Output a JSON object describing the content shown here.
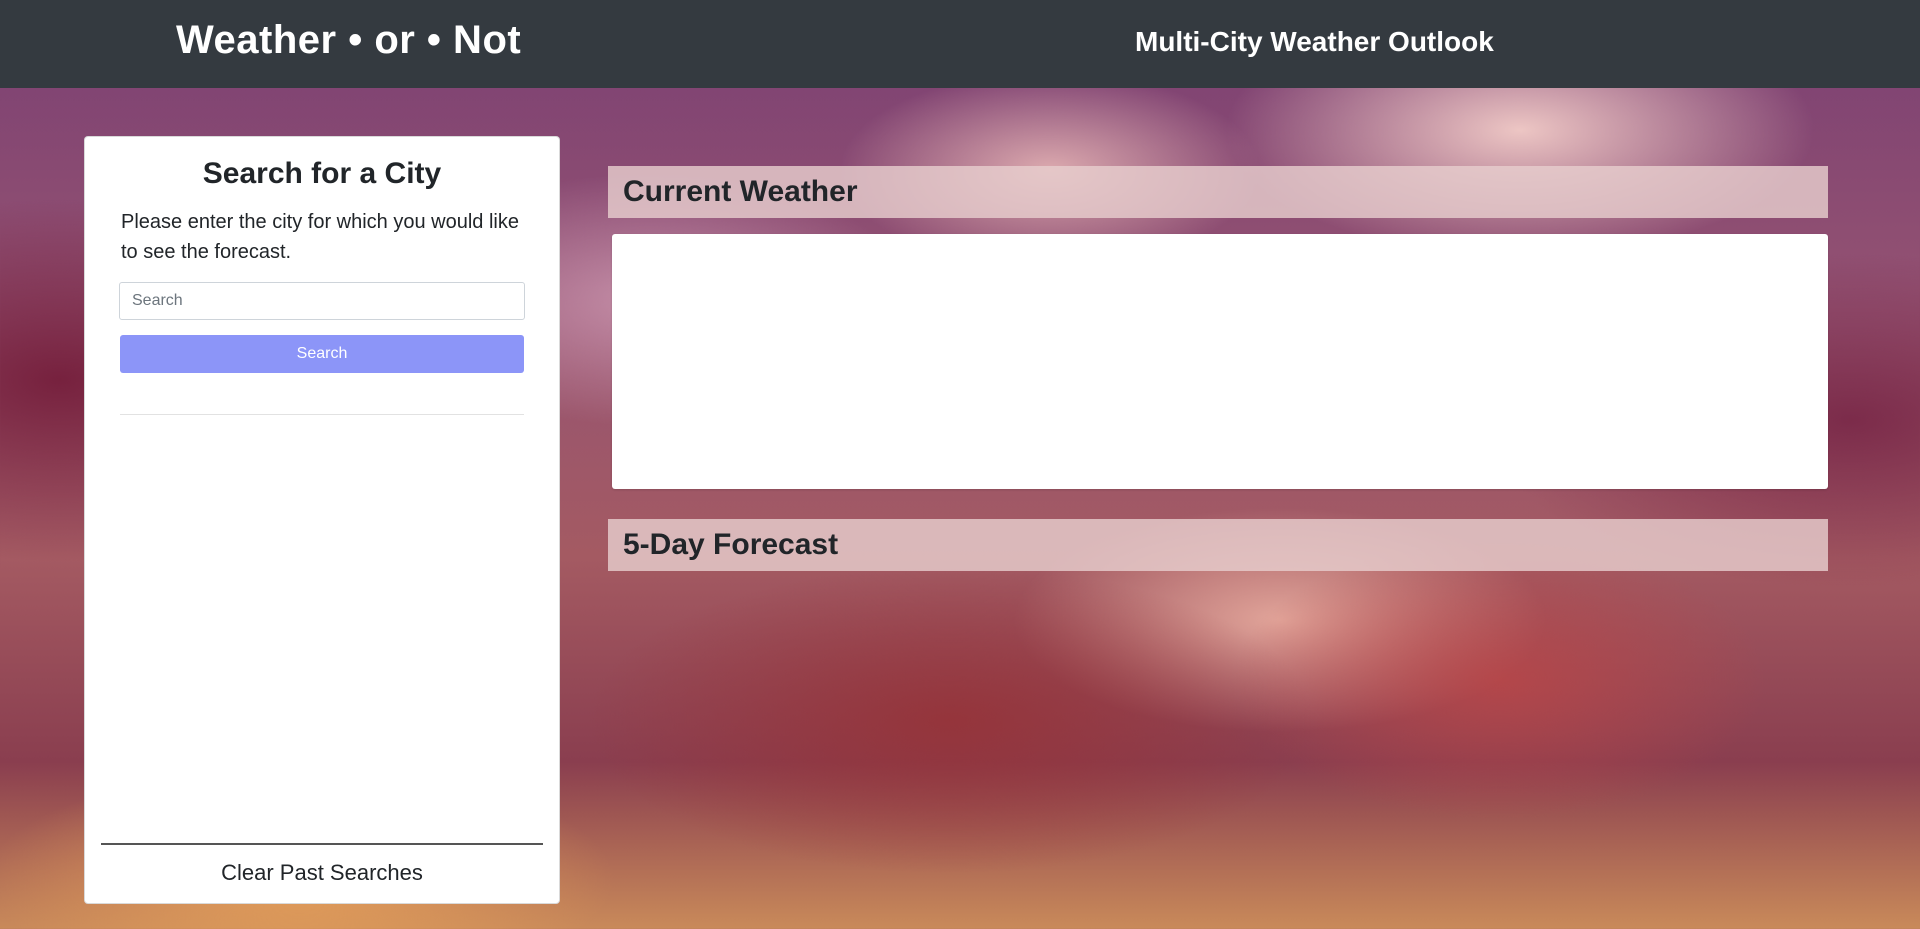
{
  "header": {
    "brand": "Weather • or • Not",
    "title": "Multi-City Weather Outlook"
  },
  "search_panel": {
    "title": "Search for a City",
    "description": "Please enter the city for which you would like to see the forecast.",
    "input_placeholder": "Search",
    "input_value": "",
    "search_button_label": "Search",
    "past_searches": [],
    "clear_button_label": "Clear Past Searches"
  },
  "main": {
    "current_weather_title": "Current Weather",
    "forecast_title": "5-Day Forecast"
  },
  "colors": {
    "navbar_bg": "#343a40",
    "search_button_bg": "#8c95f8",
    "section_header_bg": "#e6cdcd"
  }
}
